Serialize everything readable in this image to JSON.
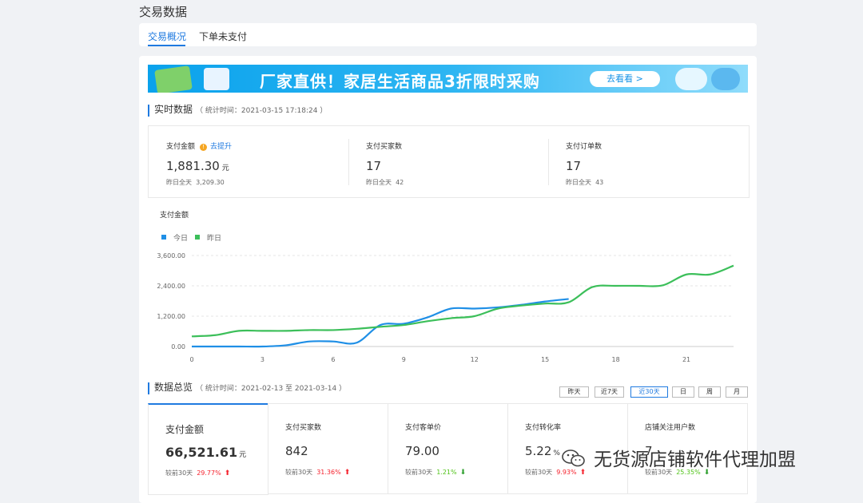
{
  "page": {
    "title": "交易数据"
  },
  "tabs": [
    {
      "label": "交易概况"
    },
    {
      "label": "下单未支付"
    }
  ],
  "banner": {
    "headline": "厂家直供！家居生活商品3折限时采购",
    "cta": "去看看 >"
  },
  "realtime": {
    "title": "实时数据",
    "subtitle": "（ 统计时间：2021-03-15 17:18:24 ）",
    "metrics": [
      {
        "label": "支付金额",
        "hint": "去提升",
        "value": "1,881.30",
        "unit": "元",
        "yesterday_label": "昨日全天",
        "yesterday_value": "3,209.30"
      },
      {
        "label": "支付买家数",
        "value": "17",
        "yesterday_label": "昨日全天",
        "yesterday_value": "42"
      },
      {
        "label": "支付订单数",
        "value": "17",
        "yesterday_label": "昨日全天",
        "yesterday_value": "43"
      }
    ]
  },
  "chart_data": {
    "type": "line",
    "title": "支付金额",
    "legend": [
      {
        "name": "今日",
        "color": "#1f8fe6"
      },
      {
        "name": "昨日",
        "color": "#3cbf5a"
      }
    ],
    "xlim": [
      0,
      23
    ],
    "ylim": [
      0,
      3600
    ],
    "x_ticks": [
      0,
      3,
      6,
      9,
      12,
      15,
      18,
      21
    ],
    "y_ticks": [
      "0.00",
      "1,200.00",
      "2,400.00",
      "3,600.00"
    ],
    "series": [
      {
        "name": "今日",
        "color": "#1f8fe6",
        "x": [
          0,
          1,
          2,
          3,
          4,
          5,
          6,
          7,
          8,
          9,
          10,
          11,
          12,
          13,
          14,
          15,
          16
        ],
        "y": [
          0,
          0,
          0,
          0,
          50,
          200,
          200,
          150,
          850,
          900,
          1150,
          1500,
          1500,
          1550,
          1650,
          1780,
          1880
        ]
      },
      {
        "name": "昨日",
        "color": "#3cbf5a",
        "x": [
          0,
          1,
          2,
          3,
          4,
          5,
          6,
          7,
          8,
          9,
          10,
          11,
          12,
          13,
          14,
          15,
          16,
          17,
          18,
          19,
          20,
          21,
          22,
          23
        ],
        "y": [
          400,
          450,
          620,
          620,
          620,
          650,
          650,
          700,
          780,
          850,
          1000,
          1120,
          1200,
          1500,
          1620,
          1700,
          1750,
          2350,
          2400,
          2400,
          2420,
          2850,
          2850,
          3200
        ]
      }
    ]
  },
  "overview": {
    "title": "数据总览",
    "subtitle": "（ 统计时间：2021-02-13 至 2021-03-14 ）",
    "filters": [
      "昨天",
      "近7天",
      "近30天",
      "日",
      "周",
      "月"
    ],
    "active_filter": "近30天",
    "cells": [
      {
        "label": "支付金额",
        "value": "66,521.61",
        "unit": "元",
        "cmp_label": "较前30天",
        "cmp_value": "29.77%",
        "trend": "up"
      },
      {
        "label": "支付买家数",
        "value": "842",
        "cmp_label": "较前30天",
        "cmp_value": "31.36%",
        "trend": "up"
      },
      {
        "label": "支付客单价",
        "value": "79.00",
        "cmp_label": "较前30天",
        "cmp_value": "1.21%",
        "trend": "down"
      },
      {
        "label": "支付转化率",
        "value": "5.22",
        "unit": "%",
        "cmp_label": "较前30天",
        "cmp_value": "9.93%",
        "trend": "up"
      },
      {
        "label": "店铺关注用户数",
        "value": "7",
        "cmp_label": "较前30天",
        "cmp_value": "25.35%",
        "trend": "down"
      }
    ]
  },
  "watermark": {
    "text": "无货源店铺软件代理加盟",
    "icon": "wechat-icon"
  },
  "colors": {
    "accent": "#1f7ae0",
    "up": "#f5222d",
    "down": "#52c41a"
  }
}
